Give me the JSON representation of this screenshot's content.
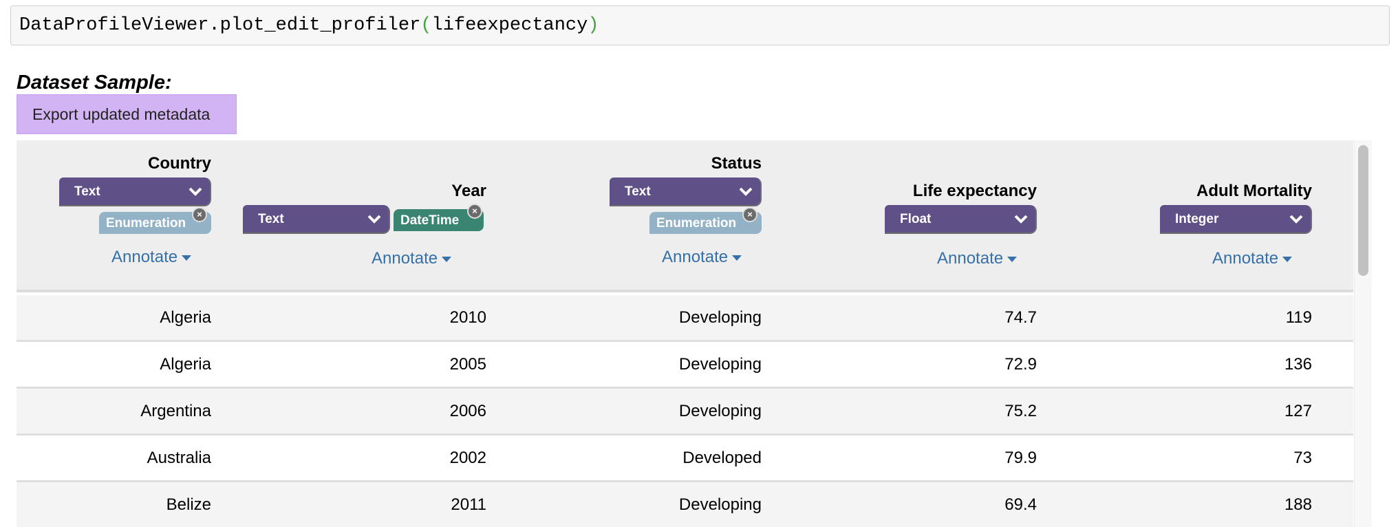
{
  "code_cell": {
    "prefix": "DataProfileViewer.plot_edit_profiler",
    "open_paren": "(",
    "argument": "lifeexpectancy",
    "close_paren": ")"
  },
  "section_title": "Dataset Sample:",
  "export_button_label": "Export updated metadata",
  "colors": {
    "select_bg": "#5f5087",
    "enum_tag": "#93b2c5",
    "datetime_tag": "#3a8571",
    "annotate_link": "#3570a8",
    "export_button": "#d2b4f5"
  },
  "columns": [
    {
      "name": "Country",
      "type": "Text",
      "tag": "Enumeration",
      "annotate": "Annotate"
    },
    {
      "name": "Year",
      "type": "Text",
      "tag": "DateTime",
      "annotate": "Annotate"
    },
    {
      "name": "Status",
      "type": "Text",
      "tag": "Enumeration",
      "annotate": "Annotate"
    },
    {
      "name": "Life expectancy",
      "type": "Float",
      "annotate": "Annotate"
    },
    {
      "name": "Adult Mortality",
      "type": "Integer",
      "annotate": "Annotate"
    }
  ],
  "rows": [
    [
      "Algeria",
      "2010",
      "Developing",
      "74.7",
      "119"
    ],
    [
      "Algeria",
      "2005",
      "Developing",
      "72.9",
      "136"
    ],
    [
      "Argentina",
      "2006",
      "Developing",
      "75.2",
      "127"
    ],
    [
      "Australia",
      "2002",
      "Developed",
      "79.9",
      "73"
    ],
    [
      "Belize",
      "2011",
      "Developing",
      "69.4",
      "188"
    ]
  ]
}
